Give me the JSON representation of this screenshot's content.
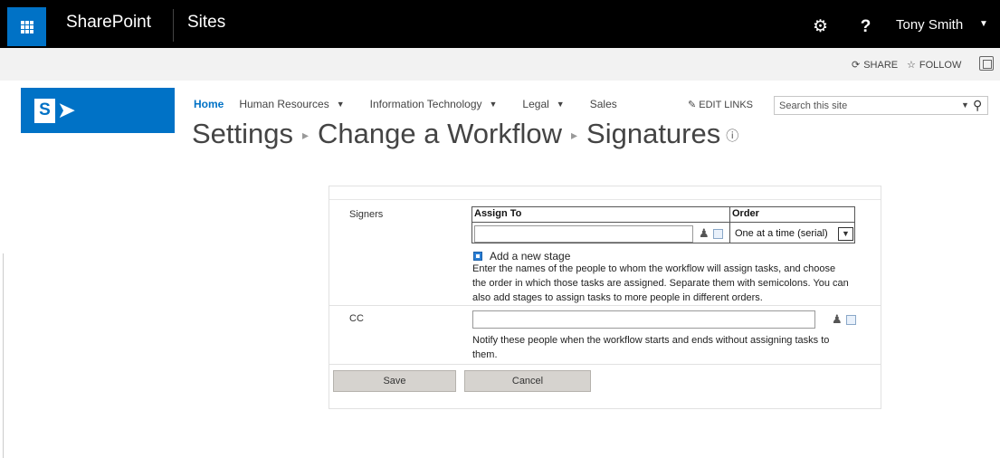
{
  "suite": {
    "brand": "SharePoint",
    "sites": "Sites",
    "help": "?",
    "user": "Tony Smith"
  },
  "ribbon": {
    "share": "SHARE",
    "follow": "FOLLOW"
  },
  "nav": {
    "home": "Home",
    "items": [
      "Human Resources",
      "Information Technology",
      "Legal",
      "Sales"
    ],
    "edit_links": "EDIT LINKS"
  },
  "search": {
    "placeholder": "Search this site"
  },
  "title": {
    "part1": "Settings",
    "part2": "Change a Workflow",
    "part3": "Signatures"
  },
  "form": {
    "signers_label": "Signers",
    "assign_to_header": "Assign To",
    "order_header": "Order",
    "order_value": "One at a time (serial)",
    "add_stage": "Add a new stage",
    "signers_help": [
      "Enter the names of the people to whom the workflow will assign tasks, and choose",
      "the order in which those tasks are assigned. Separate them with semicolons. You can",
      "also add stages to assign tasks to more people in different orders."
    ],
    "cc_label": "CC",
    "cc_help": [
      "Notify these people when the workflow starts and ends without assigning tasks to",
      "them."
    ],
    "save_label": "Save",
    "cancel_label": "Cancel"
  },
  "colors": {
    "accent": "#0072c6",
    "suitebar": "#000000",
    "button": "#d6d3cf"
  }
}
